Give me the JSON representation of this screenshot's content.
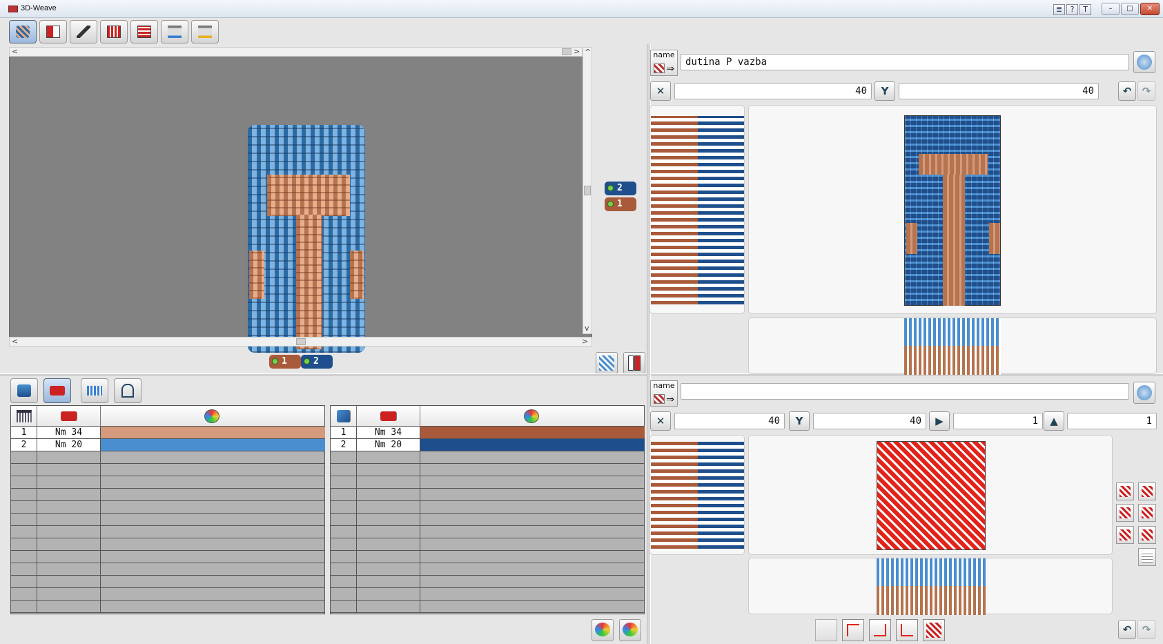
{
  "window": {
    "title": "3D-Weave",
    "controls": {
      "minimize": "–",
      "maximize": "□",
      "close": "✕",
      "help1": "?",
      "help2": "T",
      "help0": "≣"
    }
  },
  "toolbar": {
    "items": [
      "3d-view-icon",
      "pattern-icon",
      "shuttle-icon",
      "weave-grid-icon",
      "weave-grid2-icon",
      "bobbin-blue-icon",
      "bobbin-yellow-icon"
    ]
  },
  "view3d": {
    "scroll_left": "<",
    "scroll_right": ">",
    "scroll_up": "^",
    "scroll_down": "v",
    "weft_tags": [
      {
        "label": "2",
        "color": "#1e4f8c"
      },
      {
        "label": "1",
        "color": "#a85a3a"
      }
    ],
    "warp_tags": [
      {
        "label": "1",
        "color": "#a85a3a"
      },
      {
        "label": "2",
        "color": "#1e4f8c"
      }
    ]
  },
  "yarn_tabs": [
    "yarn-settings-icon",
    "thickness-icon",
    "density-icon",
    "wave-icon"
  ],
  "warp_table": {
    "rows": [
      {
        "index": "1",
        "count": "Nm 34",
        "color": "#d49a7d"
      },
      {
        "index": "2",
        "count": "Nm 20",
        "color": "#4a8ed0"
      }
    ]
  },
  "weft_table": {
    "rows": [
      {
        "index": "1",
        "count": "Nm 34",
        "color": "#a85a3a"
      },
      {
        "index": "2",
        "count": "Nm 20",
        "color": "#1e4f8c"
      }
    ]
  },
  "pattern_panel": {
    "name_label": "name",
    "name_value": "dutina P vazba",
    "width": "40",
    "height": "40"
  },
  "weave_panel": {
    "name_label": "name",
    "name_value": "",
    "width": "40",
    "height": "40",
    "step_x": "1",
    "step_y": "1"
  }
}
